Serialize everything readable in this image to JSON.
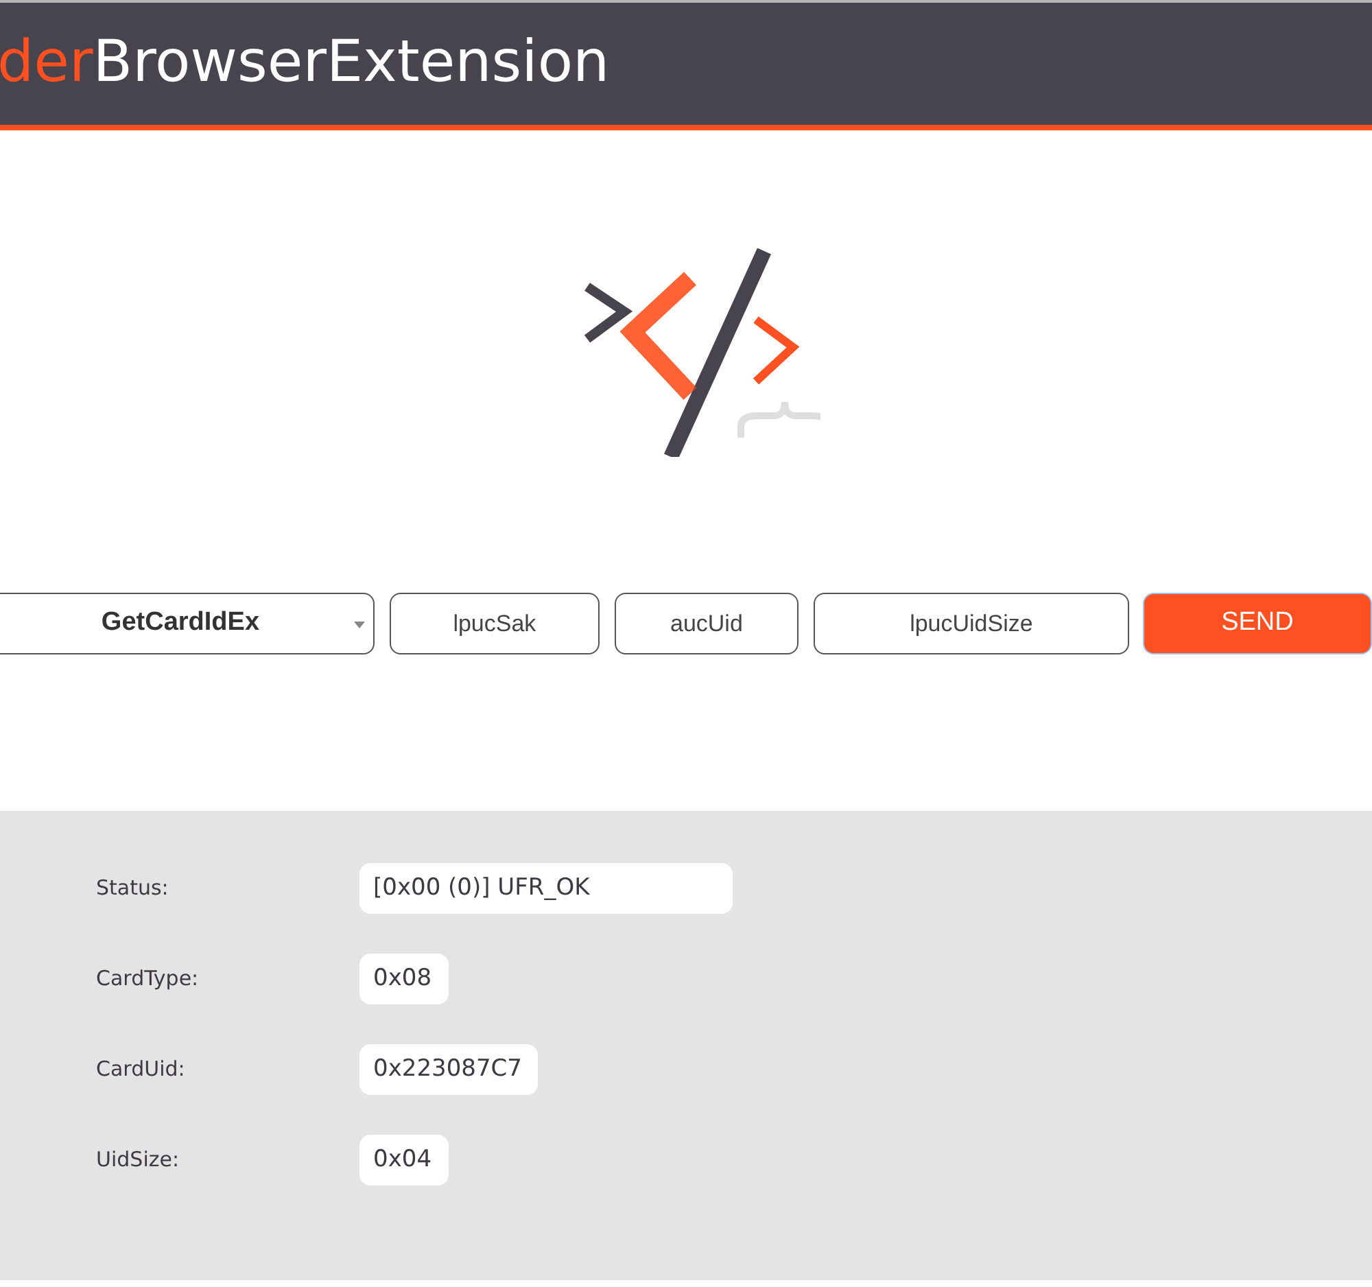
{
  "header": {
    "title_accent": "der",
    "title_main": "BrowserExtension"
  },
  "controls": {
    "function_select": {
      "value": "GetCardIdEx"
    },
    "params": [
      {
        "placeholder": "lpucSak"
      },
      {
        "placeholder": "aucUid"
      },
      {
        "placeholder": "lpucUidSize"
      }
    ],
    "send_button": "SEND"
  },
  "results": [
    {
      "label": "Status:",
      "value": "[0x00 (0)] UFR_OK"
    },
    {
      "label": "CardType:",
      "value": "0x08"
    },
    {
      "label": "CardUid:",
      "value": "0x223087C7"
    },
    {
      "label": "UidSize:",
      "value": "0x04"
    }
  ]
}
